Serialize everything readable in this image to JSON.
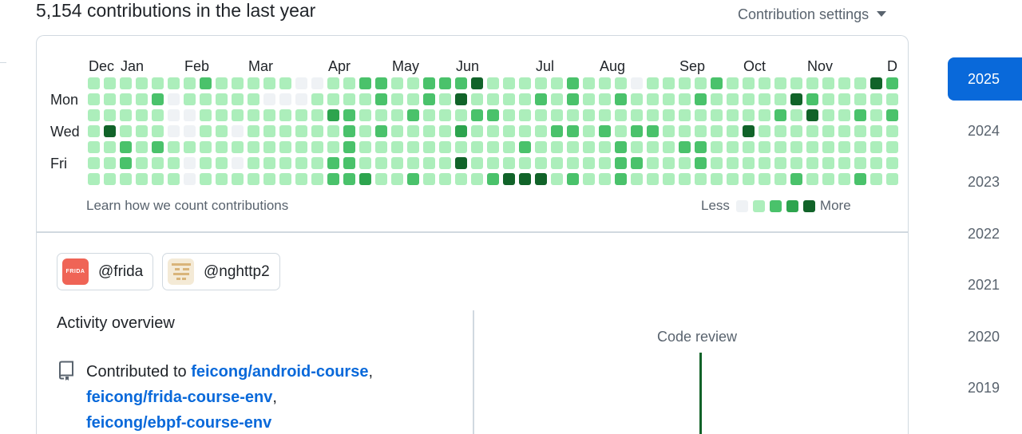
{
  "header": {
    "contributions_title": "5,154 contributions in the last year",
    "settings_label": "Contribution settings",
    "caret_icon": "chevron-down-icon"
  },
  "calendar": {
    "months": [
      "Dec",
      "Jan",
      "Feb",
      "Mar",
      "Apr",
      "May",
      "Jun",
      "Jul",
      "Aug",
      "Sep",
      "Oct",
      "Nov",
      "D"
    ],
    "day_labels": [
      "Mon",
      "Wed",
      "Fri"
    ],
    "weeks": [
      "1111111",
      "1114111",
      "1111221",
      "1111111",
      "1211211",
      "1000111",
      "1100100",
      "2111111",
      "1111111",
      "1110101",
      "1111111",
      "1011111",
      "1011111",
      "0011111",
      "0111111",
      "1131122",
      "1122222",
      "2111113",
      "2212111",
      "1111111",
      "1121112",
      "2211111",
      "2111111",
      "2413141",
      "4121111",
      "1121112",
      "1111114",
      "1111214",
      "1211114",
      "1112111",
      "2212112",
      "1111111",
      "1112111",
      "1211222",
      "0112121",
      "1112111",
      "1111111",
      "1111211",
      "1211221",
      "2111111",
      "1111111",
      "1114111",
      "1111111",
      "1121111",
      "1411112",
      "1241111",
      "1111111",
      "1111111",
      "1121112",
      "4111111",
      "2121111",
      "4221111",
      "1111111",
      "2111121",
      "1222221"
    ],
    "learn_link": "Learn how we count contributions",
    "legend_less": "Less",
    "legend_more": "More",
    "level_colors": [
      "#eff2f5",
      "#aceebb",
      "#4ac26b",
      "#2da44e",
      "#116329"
    ]
  },
  "orgs": [
    {
      "handle": "@frida",
      "avatar_text": "FRIDA",
      "avatar_color": "#ef6456"
    },
    {
      "handle": "@nghttp2",
      "avatar_color": "#f4ead6"
    }
  ],
  "activity": {
    "title": "Activity overview",
    "contributed_prefix": "Contributed to ",
    "repos": [
      "feicong/android-course",
      "feicong/frida-course-env",
      "feicong/ebpf-course-env"
    ],
    "separator": ",",
    "repo_icon": "repo-icon",
    "code_review_label": "Code review"
  },
  "years": [
    "2025",
    "2024",
    "2023",
    "2022",
    "2021",
    "2020",
    "2019"
  ],
  "selected_year": "2025"
}
